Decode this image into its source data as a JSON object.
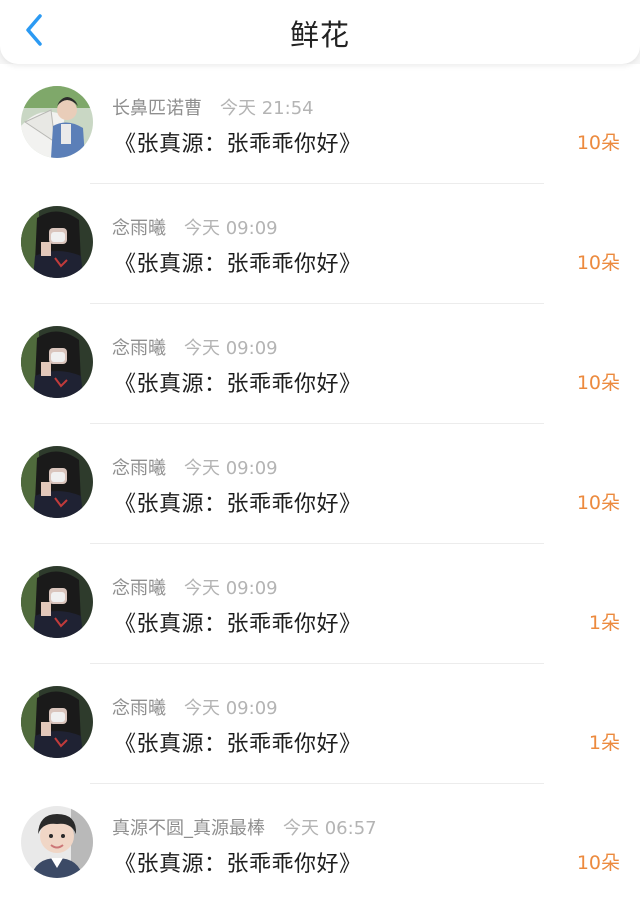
{
  "header": {
    "title": "鲜花",
    "back_icon": "chevron-left-icon",
    "accent_color": "#2b9af3"
  },
  "colors": {
    "count": "#ec8a3e",
    "name": "#8f8f8f",
    "time": "#b4b4b4",
    "message": "#1e1e1e"
  },
  "items": [
    {
      "user": "长鼻匹诺曹",
      "time": "今天 21:54",
      "message": "《张真源：张乖乖你好》",
      "count": "10朵",
      "avatar": "avatar-fan-photo"
    },
    {
      "user": "念雨曦",
      "time": "今天 09:09",
      "message": "《张真源：张乖乖你好》",
      "count": "10朵",
      "avatar": "avatar-girl-photo"
    },
    {
      "user": "念雨曦",
      "time": "今天 09:09",
      "message": "《张真源：张乖乖你好》",
      "count": "10朵",
      "avatar": "avatar-girl-photo"
    },
    {
      "user": "念雨曦",
      "time": "今天 09:09",
      "message": "《张真源：张乖乖你好》",
      "count": "10朵",
      "avatar": "avatar-girl-photo"
    },
    {
      "user": "念雨曦",
      "time": "今天 09:09",
      "message": "《张真源：张乖乖你好》",
      "count": "1朵",
      "avatar": "avatar-girl-photo"
    },
    {
      "user": "念雨曦",
      "time": "今天 09:09",
      "message": "《张真源：张乖乖你好》",
      "count": "1朵",
      "avatar": "avatar-girl-photo"
    },
    {
      "user": "真源不圆_真源最棒",
      "time": "今天 06:57",
      "message": "《张真源：张乖乖你好》",
      "count": "10朵",
      "avatar": "avatar-boy-photo"
    }
  ]
}
